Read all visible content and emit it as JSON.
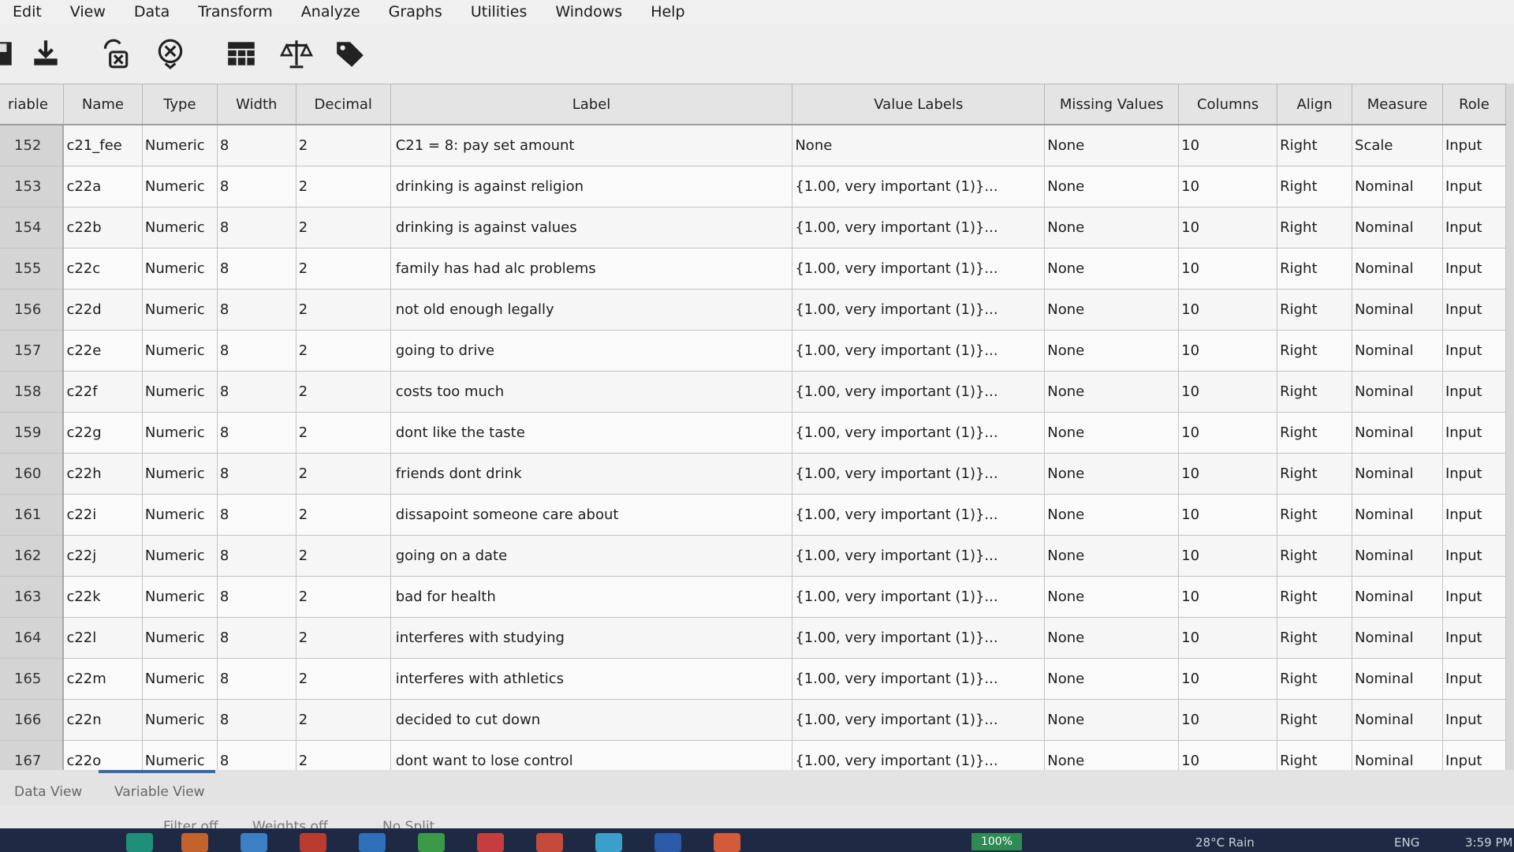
{
  "menu": [
    "Edit",
    "View",
    "Data",
    "Transform",
    "Analyze",
    "Graphs",
    "Utilities",
    "Windows",
    "Help"
  ],
  "toolbar": {
    "icons": [
      "save-icon",
      "import-icon",
      "goto-case-icon",
      "goto-variable-icon",
      "split-file-icon",
      "weight-cases-icon",
      "value-labels-icon"
    ]
  },
  "grid": {
    "headers": [
      "riable",
      "Name",
      "Type",
      "Width",
      "Decimal",
      "Label",
      "Value Labels",
      "Missing Values",
      "Columns",
      "Align",
      "Measure",
      "Role"
    ],
    "rows": [
      {
        "num": "152",
        "name": "c21_fee",
        "type": "Numeric",
        "width": "8",
        "decimal": "2",
        "label": "C21 = 8: pay set amount",
        "value_labels": "None",
        "missing": "None",
        "columns": "10",
        "align": "Right",
        "measure": "Scale",
        "role": "Input"
      },
      {
        "num": "153",
        "name": "c22a",
        "type": "Numeric",
        "width": "8",
        "decimal": "2",
        "label": "drinking is against religion",
        "value_labels": "{1.00, very important     (1)}...",
        "missing": "None",
        "columns": "10",
        "align": "Right",
        "measure": "Nominal",
        "role": "Input"
      },
      {
        "num": "154",
        "name": "c22b",
        "type": "Numeric",
        "width": "8",
        "decimal": "2",
        "label": "drinking is against values",
        "value_labels": "{1.00, very important     (1)}...",
        "missing": "None",
        "columns": "10",
        "align": "Right",
        "measure": "Nominal",
        "role": "Input"
      },
      {
        "num": "155",
        "name": "c22c",
        "type": "Numeric",
        "width": "8",
        "decimal": "2",
        "label": "family has had alc problems",
        "value_labels": "{1.00, very important     (1)}...",
        "missing": "None",
        "columns": "10",
        "align": "Right",
        "measure": "Nominal",
        "role": "Input"
      },
      {
        "num": "156",
        "name": "c22d",
        "type": "Numeric",
        "width": "8",
        "decimal": "2",
        "label": "not old enough legally",
        "value_labels": "{1.00, very important     (1)}...",
        "missing": "None",
        "columns": "10",
        "align": "Right",
        "measure": "Nominal",
        "role": "Input"
      },
      {
        "num": "157",
        "name": "c22e",
        "type": "Numeric",
        "width": "8",
        "decimal": "2",
        "label": "going to drive",
        "value_labels": "{1.00, very important     (1)}...",
        "missing": "None",
        "columns": "10",
        "align": "Right",
        "measure": "Nominal",
        "role": "Input"
      },
      {
        "num": "158",
        "name": "c22f",
        "type": "Numeric",
        "width": "8",
        "decimal": "2",
        "label": "costs too much",
        "value_labels": "{1.00, very important     (1)}...",
        "missing": "None",
        "columns": "10",
        "align": "Right",
        "measure": "Nominal",
        "role": "Input"
      },
      {
        "num": "159",
        "name": "c22g",
        "type": "Numeric",
        "width": "8",
        "decimal": "2",
        "label": "dont like the taste",
        "value_labels": "{1.00, very important     (1)}...",
        "missing": "None",
        "columns": "10",
        "align": "Right",
        "measure": "Nominal",
        "role": "Input"
      },
      {
        "num": "160",
        "name": "c22h",
        "type": "Numeric",
        "width": "8",
        "decimal": "2",
        "label": "friends dont drink",
        "value_labels": "{1.00, very important     (1)}...",
        "missing": "None",
        "columns": "10",
        "align": "Right",
        "measure": "Nominal",
        "role": "Input"
      },
      {
        "num": "161",
        "name": "c22i",
        "type": "Numeric",
        "width": "8",
        "decimal": "2",
        "label": "dissapoint someone care about",
        "value_labels": "{1.00, very important     (1)}...",
        "missing": "None",
        "columns": "10",
        "align": "Right",
        "measure": "Nominal",
        "role": "Input"
      },
      {
        "num": "162",
        "name": "c22j",
        "type": "Numeric",
        "width": "8",
        "decimal": "2",
        "label": "going on a date",
        "value_labels": "{1.00, very important     (1)}...",
        "missing": "None",
        "columns": "10",
        "align": "Right",
        "measure": "Nominal",
        "role": "Input"
      },
      {
        "num": "163",
        "name": "c22k",
        "type": "Numeric",
        "width": "8",
        "decimal": "2",
        "label": "bad for health",
        "value_labels": "{1.00, very important     (1)}...",
        "missing": "None",
        "columns": "10",
        "align": "Right",
        "measure": "Nominal",
        "role": "Input"
      },
      {
        "num": "164",
        "name": "c22l",
        "type": "Numeric",
        "width": "8",
        "decimal": "2",
        "label": "interferes with studying",
        "value_labels": "{1.00, very important     (1)}...",
        "missing": "None",
        "columns": "10",
        "align": "Right",
        "measure": "Nominal",
        "role": "Input"
      },
      {
        "num": "165",
        "name": "c22m",
        "type": "Numeric",
        "width": "8",
        "decimal": "2",
        "label": "interferes with athletics",
        "value_labels": "{1.00, very important     (1)}...",
        "missing": "None",
        "columns": "10",
        "align": "Right",
        "measure": "Nominal",
        "role": "Input"
      },
      {
        "num": "166",
        "name": "c22n",
        "type": "Numeric",
        "width": "8",
        "decimal": "2",
        "label": "decided to cut down",
        "value_labels": "{1.00, very important     (1)}...",
        "missing": "None",
        "columns": "10",
        "align": "Right",
        "measure": "Nominal",
        "role": "Input"
      },
      {
        "num": "167",
        "name": "c22o",
        "type": "Numeric",
        "width": "8",
        "decimal": "2",
        "label": "dont want to lose control",
        "value_labels": "{1.00, very important     (1)}...",
        "missing": "None",
        "columns": "10",
        "align": "Right",
        "measure": "Nominal",
        "role": "Input"
      }
    ]
  },
  "tabs": {
    "data_view": "Data View",
    "variable_view": "Variable View"
  },
  "status": {
    "filter": "Filter off",
    "weights": "Weights off",
    "split": "No Split"
  },
  "taskbar": {
    "battery": "100%",
    "weather": "28°C Rain",
    "lang": "ENG",
    "time": "3:59 PM"
  }
}
